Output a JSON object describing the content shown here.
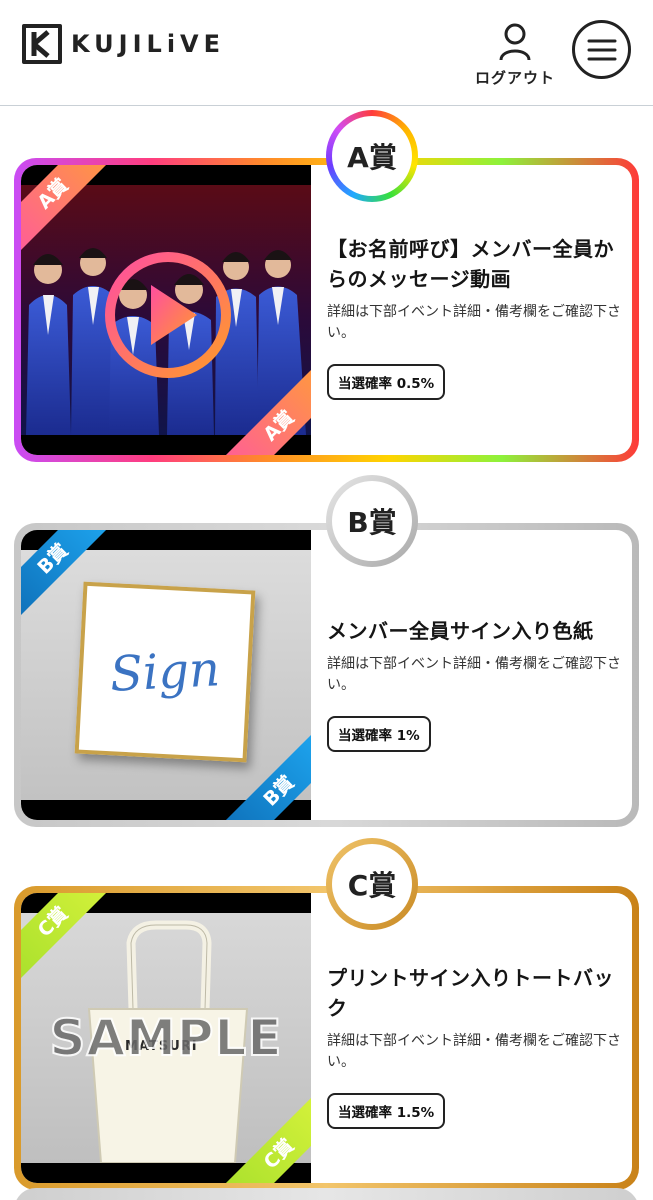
{
  "header": {
    "logo_text": "KUJILiVE",
    "logout_label": "ログアウト"
  },
  "prizes": [
    {
      "badge": "A賞",
      "ribbon": "A賞",
      "title": "【お名前呼び】メンバー全員からのメッセージ動画",
      "description": "詳細は下部イベント詳細・備考欄をご確認下さい。",
      "rate": "当選確率 0.5%"
    },
    {
      "badge": "B賞",
      "ribbon": "B賞",
      "title": "メンバー全員サイン入り色紙",
      "description": "詳細は下部イベント詳細・備考欄をご確認下さい。",
      "rate": "当選確率 1%",
      "image_text": "Sign"
    },
    {
      "badge": "C賞",
      "ribbon": "C賞",
      "title": "プリントサイン入りトートバック",
      "description": "詳細は下部イベント詳細・備考欄をご確認下さい。",
      "rate": "当選確率 1.5%",
      "image_text": "SAMPLE",
      "bag_text": "MATSURI"
    }
  ],
  "icons": [
    "kujilive-logo-icon",
    "user-icon",
    "hamburger-menu-icon",
    "play-icon"
  ]
}
